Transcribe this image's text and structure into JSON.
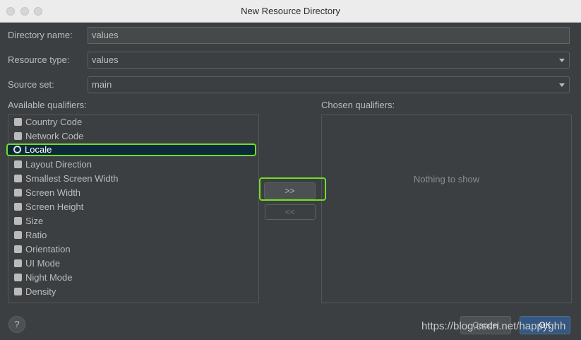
{
  "window": {
    "title": "New Resource Directory"
  },
  "form": {
    "directory_name_label": "Directory name:",
    "directory_name_value": "values",
    "resource_type_label": "Resource type:",
    "resource_type_value": "values",
    "source_set_label": "Source set:",
    "source_set_value": "main"
  },
  "available": {
    "label": "Available qualifiers:",
    "items": [
      {
        "label": "Country Code",
        "icon": "country-code-icon"
      },
      {
        "label": "Network Code",
        "icon": "network-code-icon"
      },
      {
        "label": "Locale",
        "icon": "globe-icon",
        "selected": true
      },
      {
        "label": "Layout Direction",
        "icon": "layout-direction-icon"
      },
      {
        "label": "Smallest Screen Width",
        "icon": "width-arrows-icon"
      },
      {
        "label": "Screen Width",
        "icon": "width-arrows-icon"
      },
      {
        "label": "Screen Height",
        "icon": "height-arrows-icon"
      },
      {
        "label": "Size",
        "icon": "size-icon"
      },
      {
        "label": "Ratio",
        "icon": "ratio-icon"
      },
      {
        "label": "Orientation",
        "icon": "orientation-icon"
      },
      {
        "label": "UI Mode",
        "icon": "ui-mode-icon"
      },
      {
        "label": "Night Mode",
        "icon": "night-mode-icon"
      },
      {
        "label": "Density",
        "icon": "density-icon"
      }
    ]
  },
  "chosen": {
    "label": "Chosen qualifiers:",
    "empty_text": "Nothing to show"
  },
  "buttons": {
    "add": ">>",
    "remove": "<<",
    "help": "?",
    "cancel": "Cancel",
    "ok": "OK"
  },
  "watermark": "https://blog.csdn.net/happyghh",
  "colors": {
    "highlight": "#6fde27",
    "selection": "#0d293e",
    "ok_button": "#365880"
  }
}
